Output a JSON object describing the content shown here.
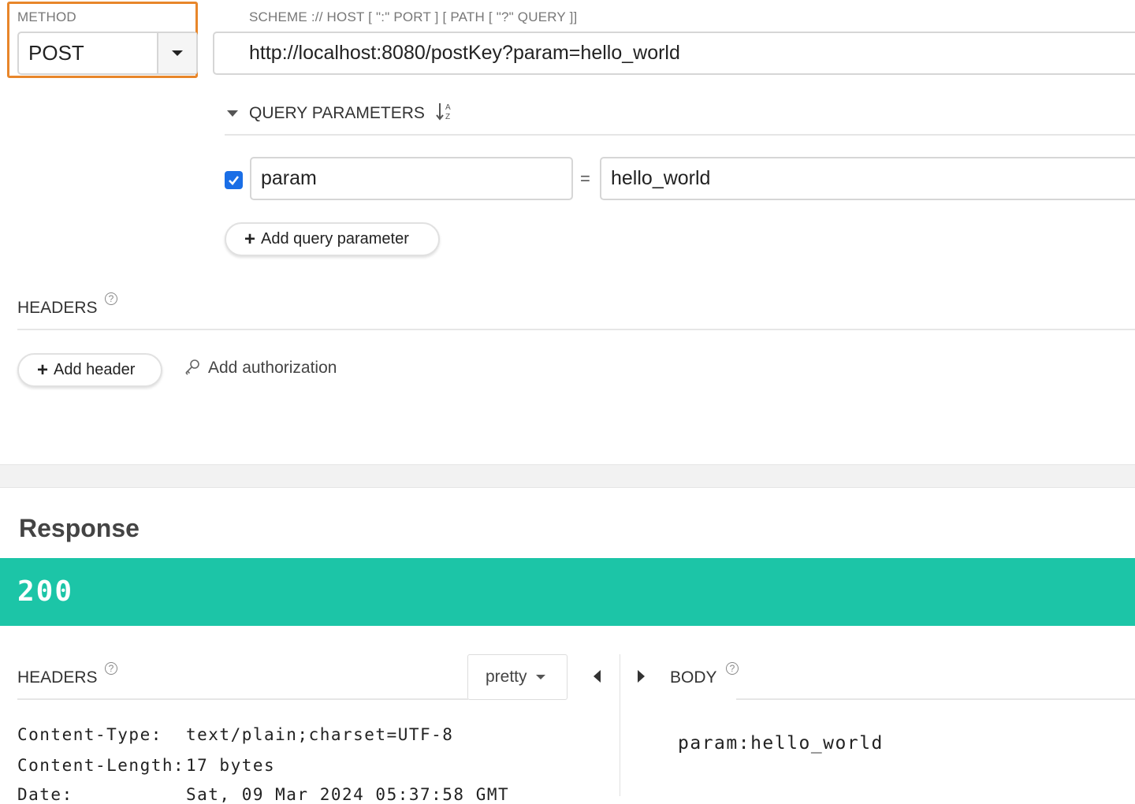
{
  "request": {
    "method": {
      "label": "METHOD",
      "value": "POST"
    },
    "url": {
      "label": "SCHEME :// HOST [ \":\" PORT ] [ PATH [ \"?\" QUERY ]]",
      "value": "http://localhost:8080/postKey?param=hello_world"
    },
    "query_parameters": {
      "title": "QUERY PARAMETERS",
      "params": [
        {
          "enabled": true,
          "key": "param",
          "separator": "=",
          "value": "hello_world"
        }
      ],
      "add_label": "Add query parameter"
    },
    "headers": {
      "title": "HEADERS",
      "help": "?",
      "add_header_label": "Add header",
      "add_auth_label": "Add authorization"
    }
  },
  "response": {
    "title": "Response",
    "status_code": "200",
    "status_color": "#1cc5a7",
    "headers": {
      "title": "HEADERS",
      "help": "?",
      "format": "pretty",
      "rows": [
        {
          "name": "Content-Type:",
          "value": "text/plain;charset=UTF-8"
        },
        {
          "name": "Content-Length:",
          "value": "17 bytes"
        },
        {
          "name": "Date:",
          "value": "Sat, 09 Mar 2024 05:37:58 GMT"
        }
      ]
    },
    "body": {
      "title": "BODY",
      "help": "?",
      "content": "param:hello_world"
    }
  },
  "colors": {
    "highlight": "#e8862a",
    "checkbox": "#1a6ee6"
  }
}
